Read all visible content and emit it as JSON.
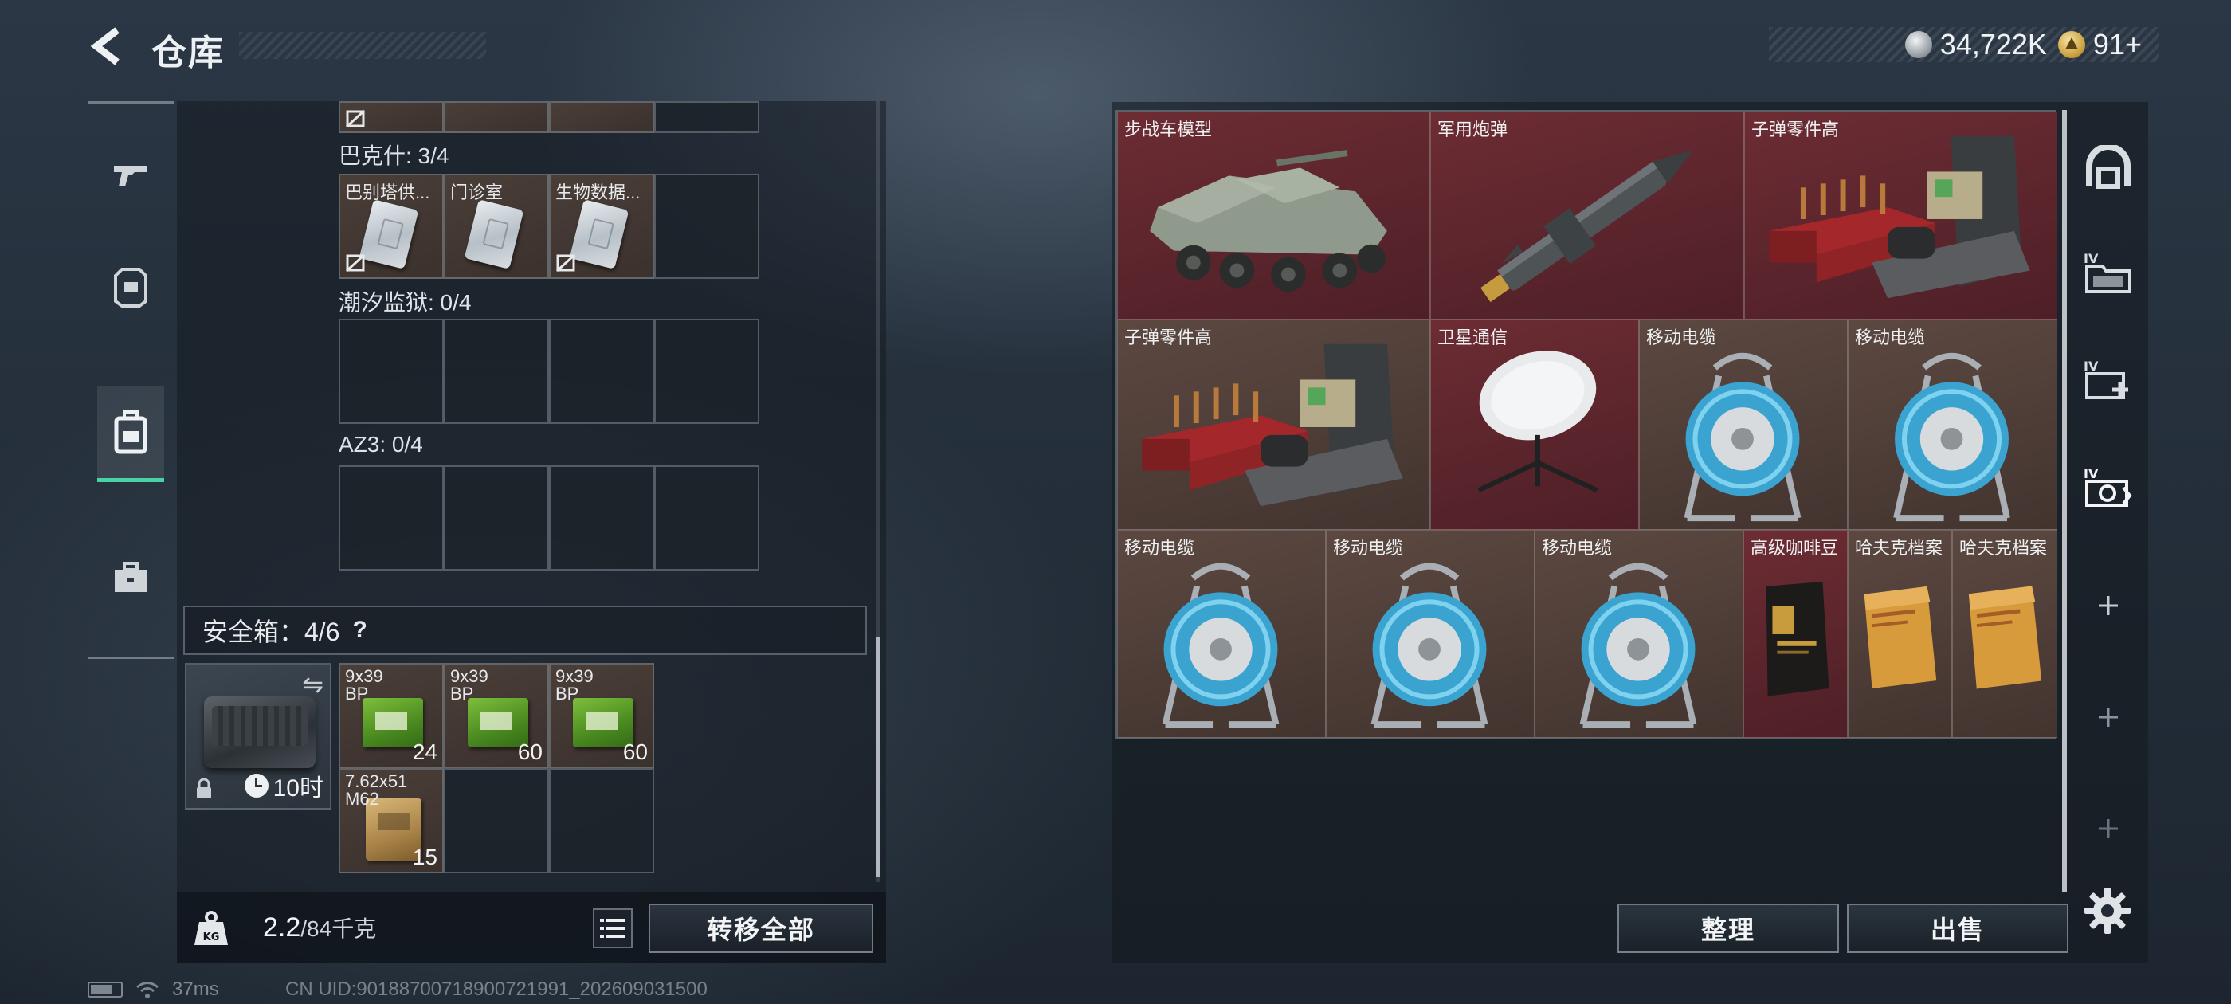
{
  "header": {
    "title": "仓库",
    "currency": [
      {
        "icon": "silver-coin-icon",
        "value": "34,722K"
      },
      {
        "icon": "gold-coin-icon",
        "value": "91+"
      }
    ]
  },
  "left_nav": [
    {
      "icon": "gun-icon",
      "active": false
    },
    {
      "icon": "armor-icon",
      "active": false
    },
    {
      "icon": "backpack-icon",
      "active": true
    },
    {
      "icon": "briefcase-icon",
      "active": false
    }
  ],
  "container_sections": [
    {
      "label": "巴克什: 3/4",
      "slots": [
        "巴别塔供...",
        "门诊室",
        "生物数据..."
      ]
    },
    {
      "label": "潮汐监狱: 0/4",
      "slots": []
    },
    {
      "label": "AZ3: 0/4",
      "slots": []
    }
  ],
  "safebox": {
    "label": "安全箱：4/6",
    "help": "?",
    "timer": "10时",
    "items": [
      {
        "label": "9x39\nBP",
        "count": "24"
      },
      {
        "label": "9x39\nBP",
        "count": "60"
      },
      {
        "label": "9x39\nBP",
        "count": "60"
      },
      {
        "label": "7.62x51\nM62",
        "count": "15"
      }
    ]
  },
  "bottom_bar": {
    "weight_current": "2.2",
    "weight_max": "/84千克",
    "transfer_all": "转移全部"
  },
  "stash": {
    "items": [
      {
        "name": "步战车模型",
        "rarity": "red",
        "art": "ifv"
      },
      {
        "name": "军用炮弹",
        "rarity": "red",
        "art": "shell"
      },
      {
        "name": "子弹零件高",
        "rarity": "red",
        "art": "ammo-parts"
      },
      {
        "name": "子弹零件高",
        "rarity": "red",
        "art": "ammo-parts"
      },
      {
        "name": "卫星通信",
        "rarity": "red",
        "art": "satellite"
      },
      {
        "name": "移动电缆",
        "rarity": "brown",
        "art": "cable"
      },
      {
        "name": "移动电缆",
        "rarity": "brown",
        "art": "cable"
      },
      {
        "name": "移动电缆",
        "rarity": "brown",
        "art": "cable"
      },
      {
        "name": "移动电缆",
        "rarity": "brown",
        "art": "cable"
      },
      {
        "name": "移动电缆",
        "rarity": "brown",
        "art": "cable"
      },
      {
        "name": "高级咖啡豆",
        "rarity": "red",
        "art": "coffee"
      },
      {
        "name": "哈夫克档案",
        "rarity": "brown",
        "art": "file"
      },
      {
        "name": "哈夫克档案",
        "rarity": "brown",
        "art": "file"
      }
    ]
  },
  "actions": {
    "sort": "整理",
    "sell": "出售"
  },
  "side_tools": [
    {
      "icon": "headset-icon"
    },
    {
      "icon": "tier-iv-folder-icon"
    },
    {
      "icon": "tier-iv-add-icon"
    },
    {
      "icon": "tier-iv-gear-icon"
    },
    {
      "icon": "plus-icon"
    },
    {
      "icon": "plus-icon"
    },
    {
      "icon": "plus-icon"
    }
  ],
  "status": {
    "ping": "37ms",
    "uid": "CN UID:9018870071890072​1991_202609031500"
  },
  "colors": {
    "active_accent": "#49d3a4",
    "rarity_red": "#6d2c33",
    "rarity_brown": "#5c4841"
  }
}
